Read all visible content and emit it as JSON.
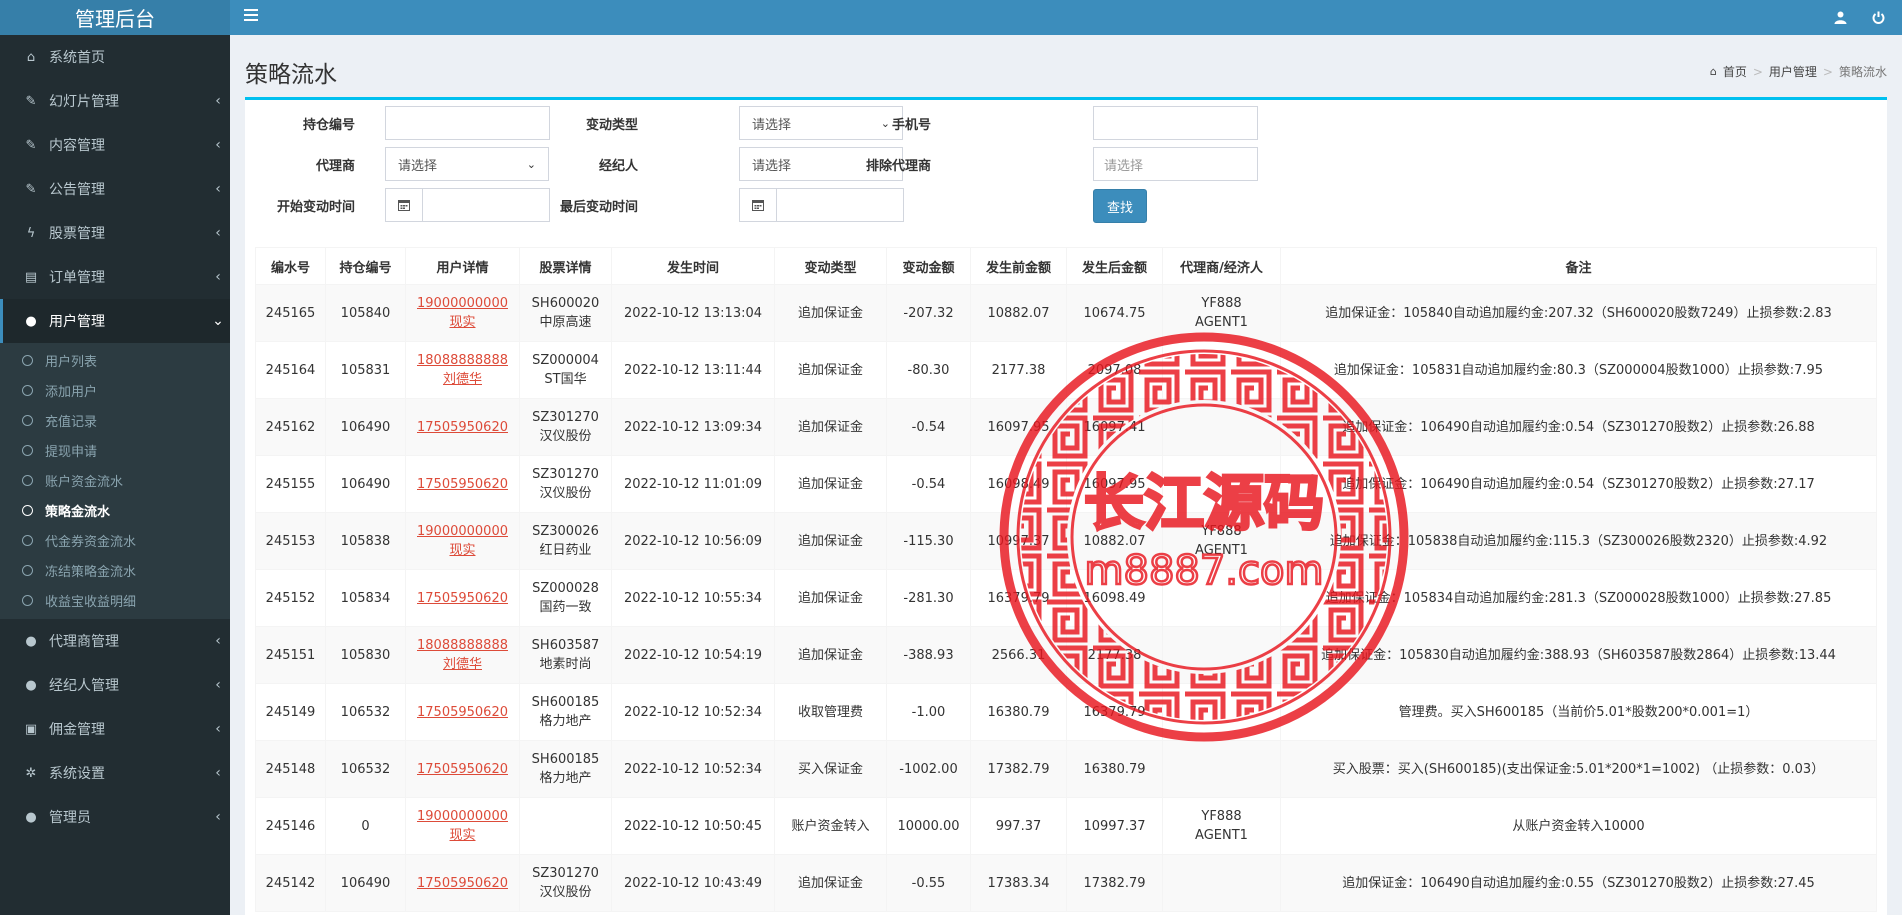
{
  "app": {
    "title": "管理后台"
  },
  "sidebar": {
    "items": [
      {
        "label": "系统首页",
        "icon": "home-icon",
        "glyph": "⌂",
        "chevron": false
      },
      {
        "label": "幻灯片管理",
        "icon": "edit-icon",
        "glyph": "✎",
        "chevron": true
      },
      {
        "label": "内容管理",
        "icon": "edit-icon",
        "glyph": "✎",
        "chevron": true
      },
      {
        "label": "公告管理",
        "icon": "edit-icon",
        "glyph": "✎",
        "chevron": true
      },
      {
        "label": "股票管理",
        "icon": "bolt-icon",
        "glyph": "ϟ",
        "chevron": true
      },
      {
        "label": "订单管理",
        "icon": "book-icon",
        "glyph": "▤",
        "chevron": true
      }
    ],
    "active_group": {
      "label": "用户管理",
      "icon": "user-icon",
      "glyph": "●"
    },
    "sub_items": [
      {
        "label": "用户列表",
        "active": false
      },
      {
        "label": "添加用户",
        "active": false
      },
      {
        "label": "充值记录",
        "active": false
      },
      {
        "label": "提现申请",
        "active": false
      },
      {
        "label": "账户资金流水",
        "active": false
      },
      {
        "label": "策略金流水",
        "active": true
      },
      {
        "label": "代金券资金流水",
        "active": false
      },
      {
        "label": "冻结策略金流水",
        "active": false
      },
      {
        "label": "收益宝收益明细",
        "active": false
      }
    ],
    "after_items": [
      {
        "label": "代理商管理",
        "icon": "user-icon",
        "glyph": "●",
        "chevron": true
      },
      {
        "label": "经纪人管理",
        "icon": "user-icon",
        "glyph": "●",
        "chevron": true
      },
      {
        "label": "佣金管理",
        "icon": "money-icon",
        "glyph": "▣",
        "chevron": true
      },
      {
        "label": "系统设置",
        "icon": "gear-icon",
        "glyph": "✲",
        "chevron": true
      },
      {
        "label": "管理员",
        "icon": "user-icon",
        "glyph": "●",
        "chevron": true
      }
    ]
  },
  "header": {
    "page_title": "策略流水",
    "breadcrumb": [
      "首页",
      "用户管理",
      "策略流水"
    ]
  },
  "filters": {
    "position_no": {
      "label": "持仓编号",
      "value": ""
    },
    "change_type": {
      "label": "变动类型",
      "selected": "请选择"
    },
    "phone": {
      "label": "手机号",
      "value": ""
    },
    "agent": {
      "label": "代理商",
      "selected": "请选择"
    },
    "broker": {
      "label": "经纪人",
      "selected": "请选择"
    },
    "exclude_agent": {
      "label": "排除代理商",
      "placeholder": "请选择"
    },
    "start_time": {
      "label": "开始变动时间",
      "value": ""
    },
    "end_time": {
      "label": "最后变动时间",
      "value": ""
    },
    "search_label": "查找"
  },
  "table": {
    "columns": [
      "编水号",
      "持仓编号",
      "用户详情",
      "股票详情",
      "发生时间",
      "变动类型",
      "变动金额",
      "发生前金额",
      "发生后金额",
      "代理商/经济人",
      "备注"
    ],
    "rows": [
      {
        "id": "245165",
        "pos": "105840",
        "phone": "19000000000",
        "uname": "现实",
        "code": "SH600020",
        "sname": "中原高速",
        "time": "2022-10-12 13:13:04",
        "type": "追加保证金",
        "amount": "-207.32",
        "before": "10882.07",
        "after": "10674.75",
        "agent": "YF888",
        "broker": "AGENT1",
        "note": "追加保证金：105840自动追加履约金:207.32（SH600020股数7249）止损参数:2.83"
      },
      {
        "id": "245164",
        "pos": "105831",
        "phone": "18088888888",
        "uname": "刘德华",
        "code": "SZ000004",
        "sname": "ST国华",
        "time": "2022-10-12 13:11:44",
        "type": "追加保证金",
        "amount": "-80.30",
        "before": "2177.38",
        "after": "2097.08",
        "agent": "",
        "broker": "",
        "note": "追加保证金：105831自动追加履约金:80.3（SZ000004股数1000）止损参数:7.95"
      },
      {
        "id": "245162",
        "pos": "106490",
        "phone": "17505950620",
        "uname": "",
        "code": "SZ301270",
        "sname": "汉仪股份",
        "time": "2022-10-12 13:09:34",
        "type": "追加保证金",
        "amount": "-0.54",
        "before": "16097.95",
        "after": "16097.41",
        "agent": "",
        "broker": "",
        "note": "追加保证金：106490自动追加履约金:0.54（SZ301270股数2）止损参数:26.88"
      },
      {
        "id": "245155",
        "pos": "106490",
        "phone": "17505950620",
        "uname": "",
        "code": "SZ301270",
        "sname": "汉仪股份",
        "time": "2022-10-12 11:01:09",
        "type": "追加保证金",
        "amount": "-0.54",
        "before": "16098.49",
        "after": "16097.95",
        "agent": "",
        "broker": "",
        "note": "追加保证金：106490自动追加履约金:0.54（SZ301270股数2）止损参数:27.17"
      },
      {
        "id": "245153",
        "pos": "105838",
        "phone": "19000000000",
        "uname": "现实",
        "code": "SZ300026",
        "sname": "红日药业",
        "time": "2022-10-12 10:56:09",
        "type": "追加保证金",
        "amount": "-115.30",
        "before": "10997.37",
        "after": "10882.07",
        "agent": "YF888",
        "broker": "AGENT1",
        "note": "追加保证金：105838自动追加履约金:115.3（SZ300026股数2320）止损参数:4.92"
      },
      {
        "id": "245152",
        "pos": "105834",
        "phone": "17505950620",
        "uname": "",
        "code": "SZ000028",
        "sname": "国药一致",
        "time": "2022-10-12 10:55:34",
        "type": "追加保证金",
        "amount": "-281.30",
        "before": "16379.79",
        "after": "16098.49",
        "agent": "",
        "broker": "",
        "note": "追加保证金：105834自动追加履约金:281.3（SZ000028股数1000）止损参数:27.85"
      },
      {
        "id": "245151",
        "pos": "105830",
        "phone": "18088888888",
        "uname": "刘德华",
        "code": "SH603587",
        "sname": "地素时尚",
        "time": "2022-10-12 10:54:19",
        "type": "追加保证金",
        "amount": "-388.93",
        "before": "2566.31",
        "after": "2177.38",
        "agent": "",
        "broker": "",
        "note": "追加保证金：105830自动追加履约金:388.93（SH603587股数2864）止损参数:13.44"
      },
      {
        "id": "245149",
        "pos": "106532",
        "phone": "17505950620",
        "uname": "",
        "code": "SH600185",
        "sname": "格力地产",
        "time": "2022-10-12 10:52:34",
        "type": "收取管理费",
        "amount": "-1.00",
        "before": "16380.79",
        "after": "16379.79",
        "agent": "",
        "broker": "",
        "note": "管理费。买入SH600185（当前价5.01*股数200*0.001=1）"
      },
      {
        "id": "245148",
        "pos": "106532",
        "phone": "17505950620",
        "uname": "",
        "code": "SH600185",
        "sname": "格力地产",
        "time": "2022-10-12 10:52:34",
        "type": "买入保证金",
        "amount": "-1002.00",
        "before": "17382.79",
        "after": "16380.79",
        "agent": "",
        "broker": "",
        "note": "买入股票：买入(SH600185)(支出保证金:5.01*200*1=1002) （止损参数：0.03）"
      },
      {
        "id": "245146",
        "pos": "0",
        "phone": "19000000000",
        "uname": "现实",
        "code": "",
        "sname": "",
        "time": "2022-10-12 10:50:45",
        "type": "账户资金转入",
        "amount": "10000.00",
        "before": "997.37",
        "after": "10997.37",
        "agent": "YF888",
        "broker": "AGENT1",
        "note": "从账户资金转入10000"
      },
      {
        "id": "245142",
        "pos": "106490",
        "phone": "17505950620",
        "uname": "",
        "code": "SZ301270",
        "sname": "汉仪股份",
        "time": "2022-10-12 10:43:49",
        "type": "追加保证金",
        "amount": "-0.55",
        "before": "17383.34",
        "after": "17382.79",
        "agent": "",
        "broker": "",
        "note": "追加保证金：106490自动追加履约金:0.55（SZ301270股数2）止损参数:27.45"
      }
    ]
  },
  "watermark": {
    "title": "长江源码",
    "domain": "m8887.com"
  },
  "colors": {
    "brand": "#3c8dbc",
    "sidebar": "#222d32",
    "link": "#dd4b39",
    "watermark": "#e8161e"
  }
}
